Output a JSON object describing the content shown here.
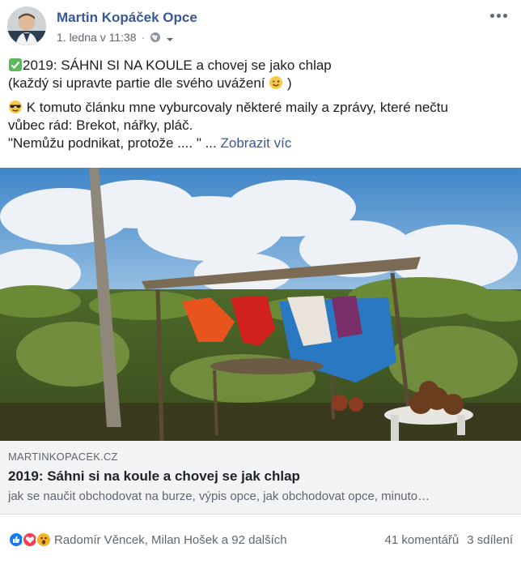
{
  "post": {
    "author": "Martin Kopáček Opce",
    "date": "1. ledna v 11:38",
    "dot": "·",
    "line1": "2019: SÁHNI SI NA KOULE a chovej se jako chlap",
    "line2": "(každý si upravte partie dle svého uvážení",
    "line2_end": ")",
    "line3": "K tomuto článku mne vyburcovaly některé maily a zprávy, které nečtu",
    "line4": "vůbec rád: Brekot, nářky, pláč.",
    "line5": "\"Nemůžu podnikat, protože .... \" ...",
    "see_more": "Zobrazit víc"
  },
  "link": {
    "domain": "MARTINKOPACEK.CZ",
    "title": "2019: Sáhni si na koule a chovej se jak chlap",
    "description": "jak se naučit obchodovat na burze, výpis opce, jak obchodovat opce, minuto…"
  },
  "engagement": {
    "reactors": "Radomír Věncek, Milan Hošek a 92 dalších",
    "comments": "41 komentářů",
    "shares": "3 sdílení"
  },
  "icons": {
    "check": "check-mark-emoji",
    "wink": "winking-face-emoji",
    "sunglasses": "sunglasses-emoji",
    "globe": "globe-icon",
    "like": "like-reaction",
    "love": "love-reaction",
    "wow": "wow-reaction"
  },
  "colors": {
    "author": "#385898",
    "link_meta_bg": "#f2f3f5",
    "like": "#1877f2",
    "love": "#f33e58",
    "wow": "#f7b125",
    "check": "#5cb85c"
  }
}
